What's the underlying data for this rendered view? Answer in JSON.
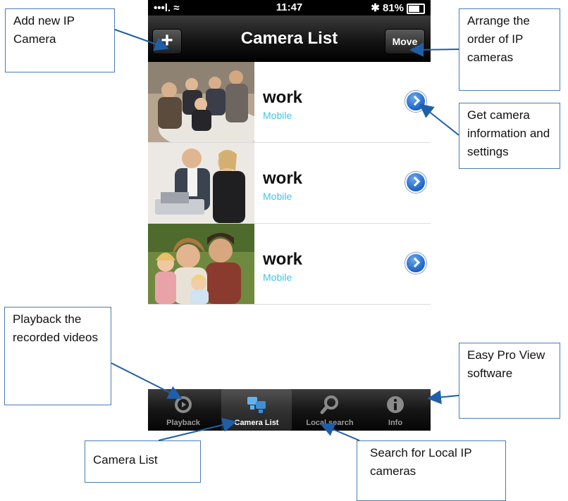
{
  "status_bar": {
    "signal": "•••l. ≈",
    "time": "11:47",
    "battery": "✱ 81%"
  },
  "nav": {
    "title": "Camera List",
    "add_label": "+",
    "move_label": "Move"
  },
  "cameras": [
    {
      "name": "work",
      "subtitle": "Mobile"
    },
    {
      "name": "work",
      "subtitle": "Mobile"
    },
    {
      "name": "work",
      "subtitle": "Mobile"
    }
  ],
  "tabs": [
    {
      "label": "Playback",
      "icon": "playback-icon",
      "active": false
    },
    {
      "label": "Camera List",
      "icon": "camera-list-icon",
      "active": true
    },
    {
      "label": "Local search",
      "icon": "search-icon",
      "active": false
    },
    {
      "label": "Info",
      "icon": "info-icon",
      "active": false
    }
  ],
  "callouts": {
    "add_camera": "Add new IP Camera",
    "arrange": "Arrange the order of IP cameras",
    "camera_info": "Get camera information and settings",
    "playback": "Playback the recorded videos",
    "easy_pro": "Easy Pro View software",
    "camera_list": "Camera List",
    "local_search": "Search for Local IP cameras"
  },
  "colors": {
    "accent_subtitle": "#3fc6ea",
    "callout_border": "#4a7bb6",
    "arrow": "#1f5fa8"
  }
}
